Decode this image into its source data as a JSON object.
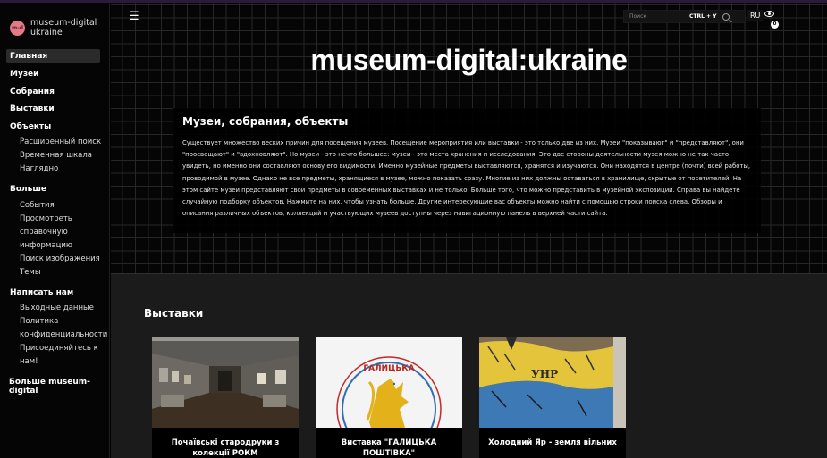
{
  "brand": {
    "logo_text": "m-d",
    "name_line1": "museum-digital",
    "name_line2": "ukraine"
  },
  "sidebar": {
    "items": [
      {
        "label": "Главная",
        "active": true
      },
      {
        "label": "Музеи"
      },
      {
        "label": "Собрания"
      },
      {
        "label": "Выставки"
      }
    ],
    "objects": {
      "label": "Объекты",
      "subitems": [
        "Расширенный поиск",
        "Временная шкала",
        "Наглядно"
      ]
    },
    "more": {
      "label": "Больше",
      "subitems": [
        "События",
        "Просмотреть справочную информацию",
        "Поиск изображения",
        "Темы"
      ]
    },
    "contact": {
      "label": "Написать нам",
      "subitems": [
        "Выходные данные",
        "Политика конфиденциальности",
        "Присоединяйтесь к нам!"
      ]
    },
    "more_md": "Больше museum-digital"
  },
  "header": {
    "menu_icon": "hamburger-icon",
    "search_placeholder": "Поиск",
    "shortcut": "CTRL + Y",
    "language": "RU",
    "watch_count": "0"
  },
  "hero": {
    "title": "museum-digital:ukraine",
    "intro_title": "Музеи, собрания, объекты",
    "intro_text": "Существует множество веских причин для посещения музеев. Посещение мероприятия или выставки - это только две из них. Музеи \"показывают\" и \"представляют\", они \"просвещают\" и \"вдохновляют\". Но музеи - это нечто большее: музеи - это места хранения и исследования. Это две стороны деятельности музея можно не так часто увидеть, но именно они составляют основу его видимости. Именно музейные предметы выставляются, хранятся и изучаются. Они находятся в центре (почти) всей работы, проводимой в музее. Однако не все предметы, хранящиеся в музее, можно показать сразу. Многие из них должны оставаться в хранилище, скрытые от посетителей. На этом сайте музеи представляют свои предметы в современных выставках и не только. Больше того, что можно представить в музейной экспозиции. Справа вы найдете случайную подборку объектов. Нажмите на них, чтобы узнать больше. Другие интересующие вас объекты можно найти с помощью строки поиска слева. Обзоры и описания различных объектов, коллекций и участвующих музеев доступны через навигационную панель в верхней части сайта."
  },
  "exhibitions": {
    "title": "Выставки",
    "cards": [
      {
        "title": "Почаївські стародруки з колекції РОКМ"
      },
      {
        "title": "Виставка \"ГАЛИЦЬКА ПОШТІВКА\"",
        "image_text": "ГАЛИЦЬКА"
      },
      {
        "title": "Холодний Яр - земля вільних"
      }
    ]
  },
  "colors": {
    "background": "#000000",
    "grid": "#262626",
    "lower_bg": "#1b1b1b",
    "logo": "#e37a8a",
    "accent_yellow": "#e3b21b",
    "accent_blue": "#2e6fb0"
  }
}
